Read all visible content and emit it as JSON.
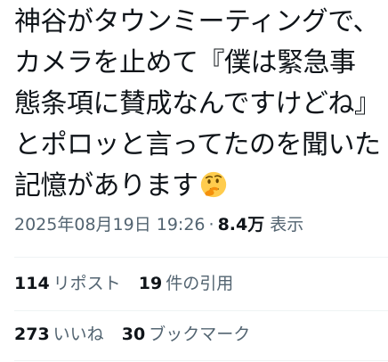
{
  "tweet": {
    "lines": [
      "神谷がタウンミーティングで、",
      "カメラを止めて『僕は緊急事",
      "態条項に賛成なんですけどね』",
      "とポロッと言ってたのを聞いた",
      "記憶があります"
    ],
    "emoji_icon": "thinking-face-icon"
  },
  "meta": {
    "timestamp": "2025年08月19日 19:26",
    "separator": "·",
    "views_count": "8.4万",
    "views_label": "表示"
  },
  "stats": {
    "reposts": {
      "count": "114",
      "label": "リポスト"
    },
    "quotes": {
      "count": "19",
      "label": "件の引用"
    },
    "likes": {
      "count": "273",
      "label": "いいね"
    },
    "bookmarks": {
      "count": "30",
      "label": "ブックマーク"
    }
  },
  "colors": {
    "text_primary": "#0f1419",
    "text_secondary": "#536471",
    "divider": "#eff3f4",
    "emoji_face": "#ffcc4d"
  }
}
